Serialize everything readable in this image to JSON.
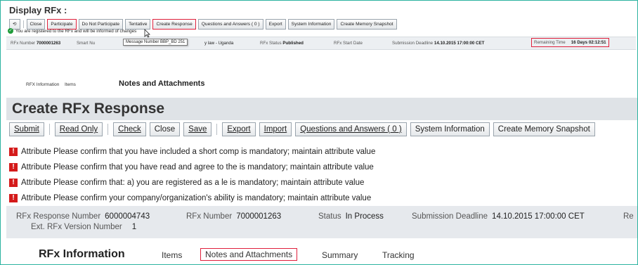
{
  "mini": {
    "title": "Display RFx :",
    "toolbar": {
      "refresh_icon": "refresh-icon",
      "close": "Close",
      "participate": "Participate",
      "do_not_participate": "Do Not Participate",
      "tentative": "Tentative",
      "create_response": "Create Response",
      "questions_answers": "Questions and Answers ( 0 )",
      "export": "Export",
      "system_information": "System Information",
      "create_memory_snapshot": "Create Memory Snapshot"
    },
    "message": "You are registered to the RFx and will be informed of changes",
    "header": {
      "rfx_number_label": "RFx Number",
      "rfx_number": "7000001263",
      "smart_label": "Smart Nu",
      "law_text": "y law - Uganda",
      "status_label": "RFx Status",
      "status": "Published",
      "start_label": "RFx Start Date",
      "deadline_label": "Submission Deadline",
      "deadline": "14.10.2015 17:00:00 CET",
      "remaining_label": "Remaining Time",
      "remaining": "16 Days 02:12:51"
    },
    "tooltip": "Message Number BBP_BD 251",
    "tabs": {
      "rfx_information": "RFX Information",
      "items": "Items",
      "notes": "Notes and Attachments"
    }
  },
  "big": {
    "title": "Create RFx Response",
    "toolbar": {
      "submit": "Submit",
      "read_only": "Read Only",
      "check": "Check",
      "close": "Close",
      "save": "Save",
      "export": "Export",
      "import": "Import",
      "questions_answers": "Questions and Answers ( 0 )",
      "system_information": "System Information",
      "create_memory_snapshot": "Create Memory Snapshot"
    },
    "errors": [
      "Attribute Please confirm that you have included a short comp is mandatory; maintain attribute value",
      "Attribute Please confirm that you have read and agree to the is mandatory; maintain attribute value",
      "Attribute Please confirm that: a) you are registered as a le is mandatory; maintain attribute value",
      "Attribute Please confirm your company/organization's ability is mandatory; maintain attribute value"
    ],
    "header": {
      "response_number_label": "RFx Response Number",
      "response_number": "6000004743",
      "rfx_number_label": "RFx Number",
      "rfx_number": "7000001263",
      "status_label": "Status",
      "status": "In Process",
      "deadline_label": "Submission Deadline",
      "deadline": "14.10.2015 17:00:00 CET",
      "cut_label": "Re",
      "ext_version_label": "Ext. RFx Version Number",
      "ext_version": "1"
    },
    "tabs": {
      "rfx_information": "RFx Information",
      "items": "Items",
      "notes": "Notes and Attachments",
      "summary": "Summary",
      "tracking": "Tracking"
    }
  },
  "colors": {
    "frame": "#2bb3a0",
    "highlight": "#e0203c",
    "error_icon": "#d41a1a",
    "success_icon": "#1f9b3a"
  }
}
